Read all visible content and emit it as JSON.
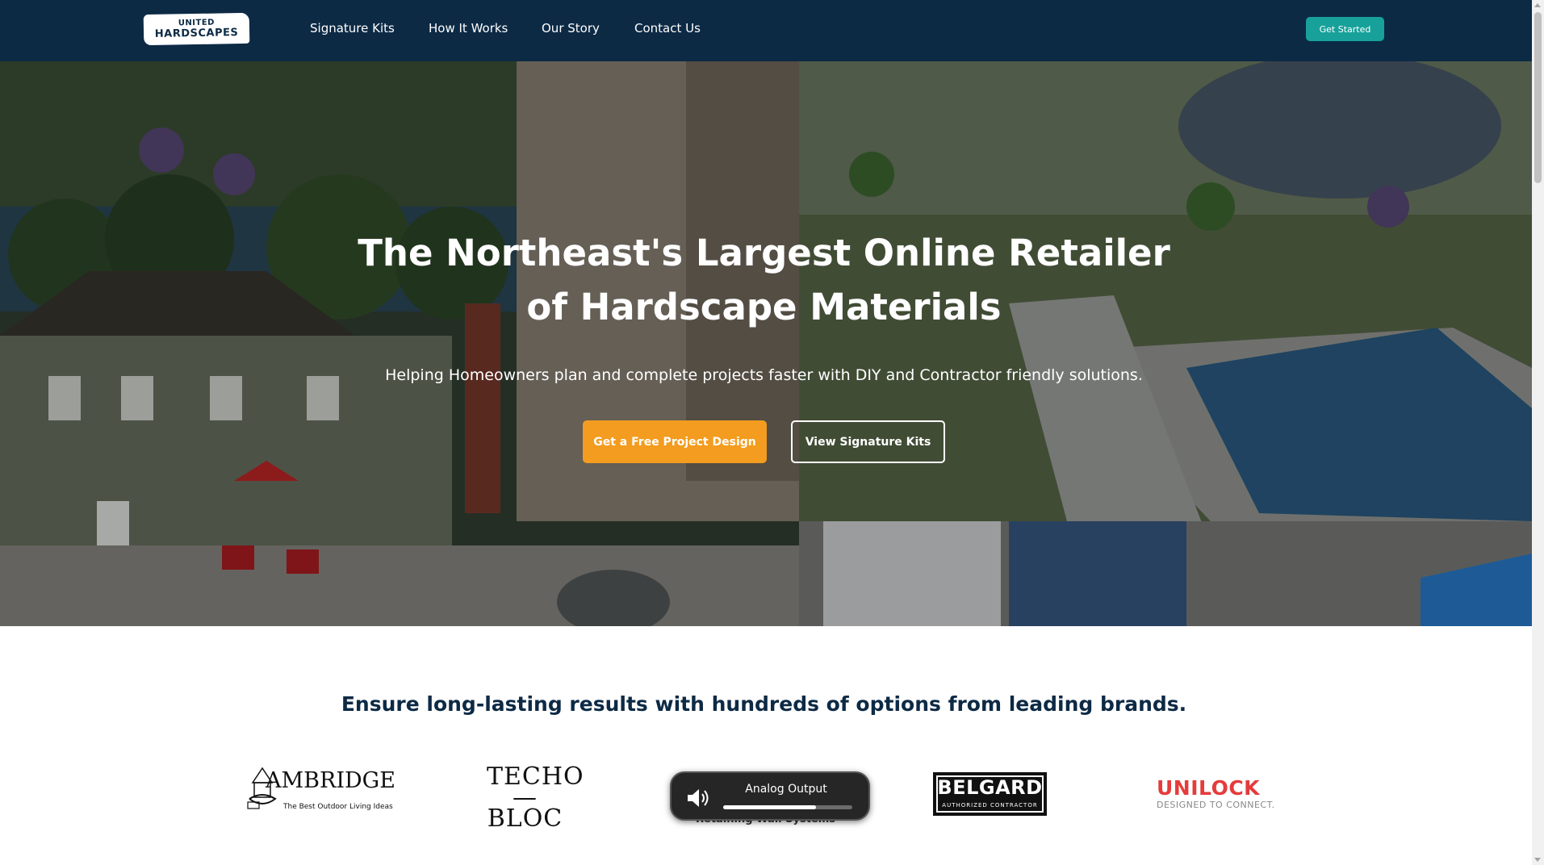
{
  "nav": {
    "logo_line1": "UNITED",
    "logo_line2": "HARDSCAPES",
    "links": [
      "Signature Kits",
      "How It Works",
      "Our Story",
      "Contact Us"
    ],
    "cta": "Get Started"
  },
  "hero": {
    "title_line1": "The Northeast's Largest Online Retailer",
    "title_line2": "of Hardscape Materials",
    "subtitle": "Helping Homeowners plan and complete projects faster with DIY and Contractor friendly solutions.",
    "primary_button": "Get a Free Project Design",
    "secondary_button": "View Signature Kits"
  },
  "brands": {
    "heading": "Ensure long-lasting results with hundreds of options from leading brands.",
    "cambridge": {
      "name": "AMBRIDGE",
      "tagline": "The Best Outdoor Living Ideas"
    },
    "techo": {
      "line1": "TECHO",
      "line2": "—BLOC"
    },
    "partially_hidden": "Retaining Wall Systems",
    "belgard": {
      "name": "BELGARD",
      "sub": "AUTHORIZED CONTRACTOR"
    },
    "unilock": {
      "name": "UNILOCK",
      "sub": "DESIGNED TO CONNECT."
    }
  },
  "audio_popup": {
    "label": "Analog Output",
    "volume_fraction": 0.72,
    "icon": "speaker-icon"
  },
  "colors": {
    "nav_bg": "#0d2a45",
    "accent_teal": "#17a19a",
    "accent_orange": "#f39c1f",
    "unilock_red": "#e53b3b"
  }
}
